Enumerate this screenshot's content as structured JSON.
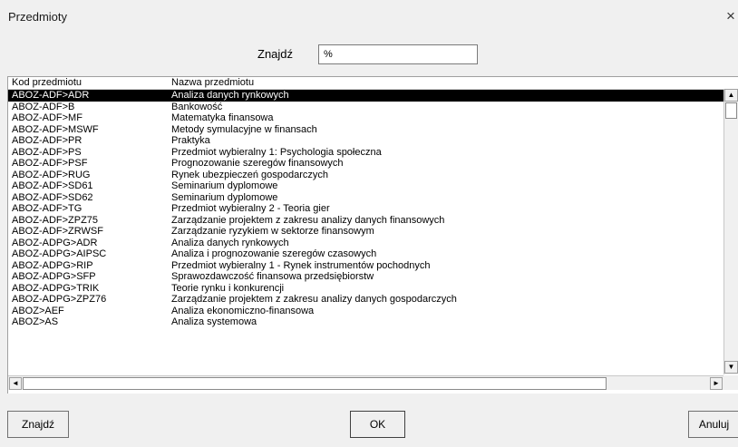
{
  "window": {
    "title": "Przedmioty",
    "close_glyph": "×"
  },
  "search": {
    "label": "Znajdź",
    "value": "%"
  },
  "list": {
    "columns": {
      "code": "Kod przedmiotu",
      "name": "Nazwa przedmiotu"
    },
    "selected_index": 0,
    "rows": [
      {
        "code": "ABOZ-ADF>ADR",
        "name": "Analiza danych rynkowych"
      },
      {
        "code": "ABOZ-ADF>B",
        "name": "Bankowość"
      },
      {
        "code": "ABOZ-ADF>MF",
        "name": "Matematyka finansowa"
      },
      {
        "code": "ABOZ-ADF>MSWF",
        "name": "Metody symulacyjne w finansach"
      },
      {
        "code": "ABOZ-ADF>PR",
        "name": "Praktyka"
      },
      {
        "code": "ABOZ-ADF>PS",
        "name": "Przedmiot wybieralny 1: Psychologia społeczna"
      },
      {
        "code": "ABOZ-ADF>PSF",
        "name": "Prognozowanie szeregów finansowych"
      },
      {
        "code": "ABOZ-ADF>RUG",
        "name": "Rynek ubezpieczeń gospodarczych"
      },
      {
        "code": "ABOZ-ADF>SD61",
        "name": "Seminarium dyplomowe"
      },
      {
        "code": "ABOZ-ADF>SD62",
        "name": "Seminarium dyplomowe"
      },
      {
        "code": "ABOZ-ADF>TG",
        "name": "Przedmiot wybieralny 2 - Teoria gier"
      },
      {
        "code": "ABOZ-ADF>ZPZ75",
        "name": "Zarządzanie projektem z zakresu analizy danych finansowych"
      },
      {
        "code": "ABOZ-ADF>ZRWSF",
        "name": "Zarządzanie ryzykiem w sektorze finansowym"
      },
      {
        "code": "ABOZ-ADPG>ADR",
        "name": "Analiza danych rynkowych"
      },
      {
        "code": "ABOZ-ADPG>AIPSC",
        "name": "Analiza i prognozowanie szeregów czasowych"
      },
      {
        "code": "ABOZ-ADPG>RIP",
        "name": "Przedmiot wybieralny 1 - Rynek instrumentów pochodnych"
      },
      {
        "code": "ABOZ-ADPG>SFP",
        "name": "Sprawozdawczość finansowa przedsiębiorstw"
      },
      {
        "code": "ABOZ-ADPG>TRIK",
        "name": "Teorie rynku i konkurencji"
      },
      {
        "code": "ABOZ-ADPG>ZPZ76",
        "name": "Zarządzanie projektem z zakresu analizy danych gospodarczych"
      },
      {
        "code": "ABOZ>AEF",
        "name": "Analiza ekonomiczno-finansowa"
      },
      {
        "code": "ABOZ>AS",
        "name": "Analiza systemowa"
      }
    ]
  },
  "scroll": {
    "up": "▲",
    "down": "▼",
    "left": "◄",
    "right": "►"
  },
  "buttons": {
    "find": "Znajdź",
    "ok": "OK",
    "cancel": "Anuluj"
  }
}
